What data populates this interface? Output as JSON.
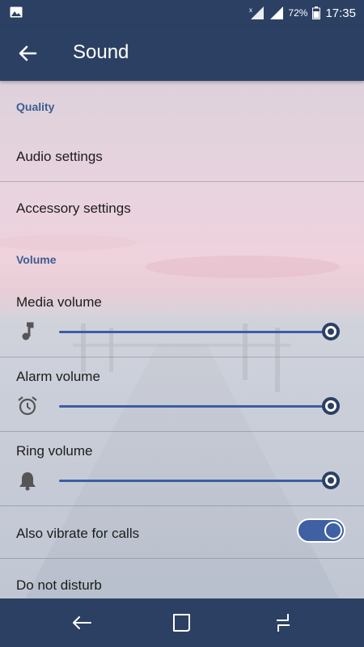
{
  "status_bar": {
    "battery_percent": "72%",
    "time": "17:35",
    "icons": [
      "image-notification-icon",
      "signal-no-sim-icon",
      "signal-icon",
      "battery-icon"
    ]
  },
  "app_bar": {
    "title": "Sound",
    "back_icon": "arrow-left-icon"
  },
  "sections": {
    "quality": {
      "header": "Quality",
      "items": [
        {
          "label": "Audio settings"
        },
        {
          "label": "Accessory settings"
        }
      ]
    },
    "volume": {
      "header": "Volume",
      "sliders": [
        {
          "label": "Media volume",
          "icon": "music-note-icon",
          "level": 1.0
        },
        {
          "label": "Alarm volume",
          "icon": "alarm-clock-icon",
          "level": 1.0
        },
        {
          "label": "Ring volume",
          "icon": "bell-icon",
          "level": 1.0
        }
      ]
    }
  },
  "vibrate": {
    "label": "Also vibrate for calls",
    "enabled": true
  },
  "do_not_disturb": {
    "label": "Do not disturb"
  },
  "nav_bar": {
    "icons": [
      "back-nav-icon",
      "home-nav-icon",
      "recents-nav-icon"
    ]
  },
  "colors": {
    "app_bar": "#2c4063",
    "accent": "#3b5ea3",
    "section_header": "#3d5d94"
  }
}
